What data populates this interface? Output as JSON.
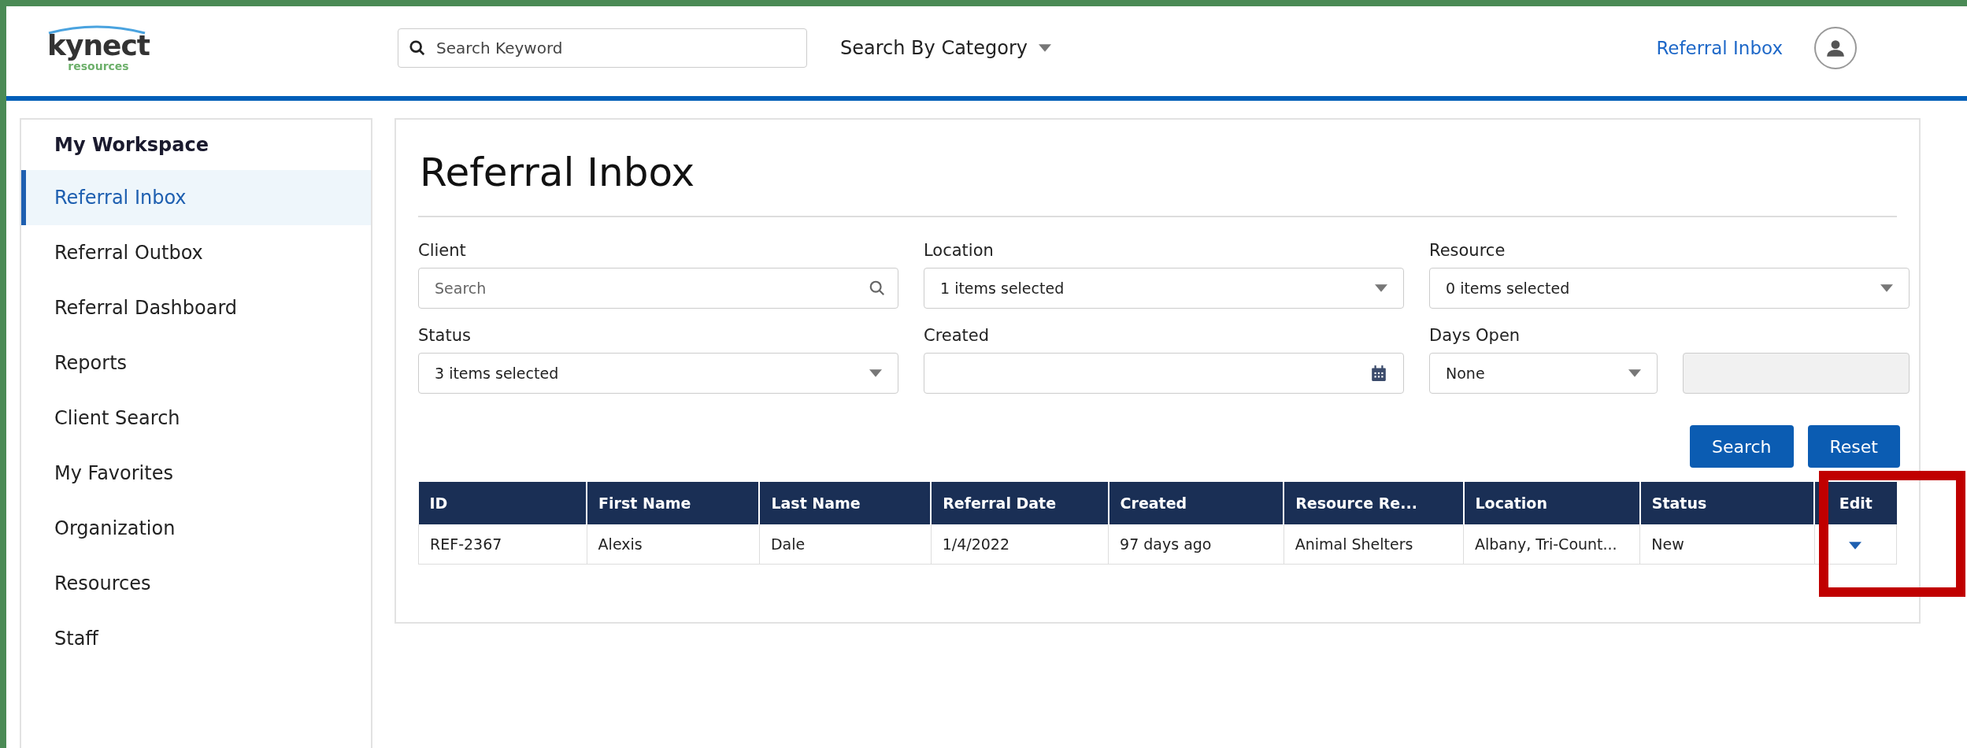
{
  "header": {
    "logo": {
      "name": "kynect",
      "sub": "resources"
    },
    "search": {
      "placeholder": "Search Keyword"
    },
    "category": "Search By Category",
    "link": "Referral Inbox"
  },
  "sidebar": {
    "title": "My Workspace",
    "items": [
      {
        "label": "Referral Inbox",
        "selected": true
      },
      {
        "label": "Referral Outbox",
        "selected": false
      },
      {
        "label": "Referral Dashboard",
        "selected": false
      },
      {
        "label": "Reports",
        "selected": false
      },
      {
        "label": "Client Search",
        "selected": false
      },
      {
        "label": "My Favorites",
        "selected": false
      },
      {
        "label": "Organization",
        "selected": false
      },
      {
        "label": "Resources",
        "selected": false
      },
      {
        "label": "Staff",
        "selected": false
      }
    ]
  },
  "page_title": "Referral Inbox",
  "filters": [
    {
      "kind": "search",
      "label": "Client",
      "placeholder": "Search"
    },
    {
      "kind": "select",
      "label": "Location",
      "value": "1 items selected"
    },
    {
      "kind": "select",
      "label": "Resource",
      "value": "0 items selected"
    },
    {
      "kind": "select",
      "label": "Status",
      "value": "3 items selected"
    },
    {
      "kind": "date",
      "label": "Created"
    },
    {
      "kind": "days",
      "label": "Days Open",
      "value": "None"
    }
  ],
  "buttons": [
    "Search",
    "Reset"
  ],
  "table": {
    "columns": [
      "ID",
      "First Name",
      "Last Name",
      "Referral Date",
      "Created",
      "Resource Re...",
      "Location",
      "Status",
      "Edit"
    ],
    "rows": [
      {
        "cells": [
          "REF-2367",
          "Alexis",
          "Dale",
          "1/4/2022",
          "97 days ago",
          "Animal Shelters",
          "Albany, Tri-Count...",
          "New"
        ]
      }
    ]
  }
}
